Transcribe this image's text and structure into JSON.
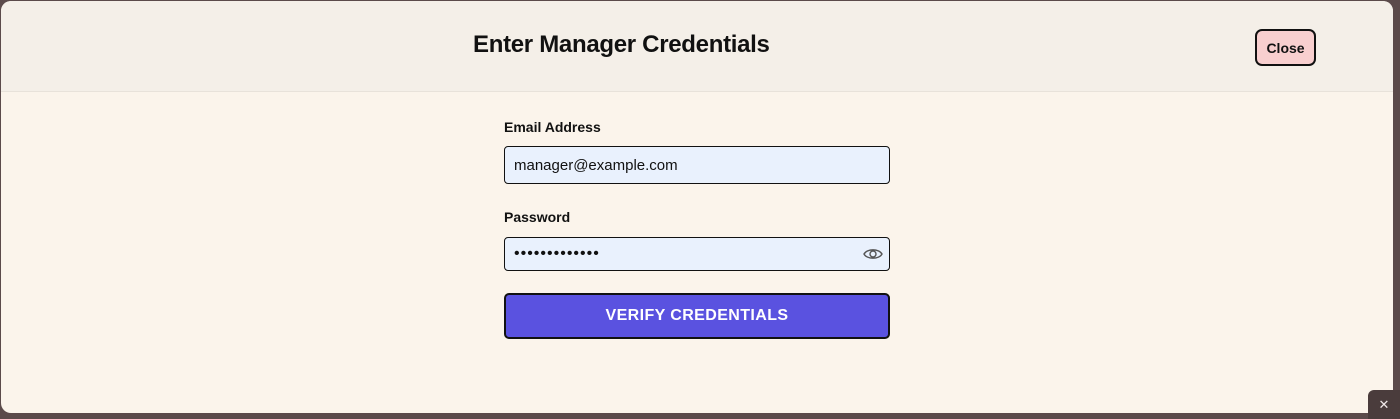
{
  "modal": {
    "title": "Enter Manager Credentials",
    "close_label": "Close"
  },
  "form": {
    "email_label": "Email Address",
    "email_value": "manager@example.com",
    "password_label": "Password",
    "password_value": "manager123456",
    "verify_label": "VERIFY CREDENTIALS"
  },
  "icons": {
    "password_toggle": "eye-icon",
    "corner_close": "close-icon"
  },
  "colors": {
    "accent": "#5a52e0",
    "close_button": "#f8cfcf",
    "input_background": "#e9f1fd",
    "modal_background": "#fbf4eb"
  },
  "corner": {
    "close_glyph": "✕"
  }
}
